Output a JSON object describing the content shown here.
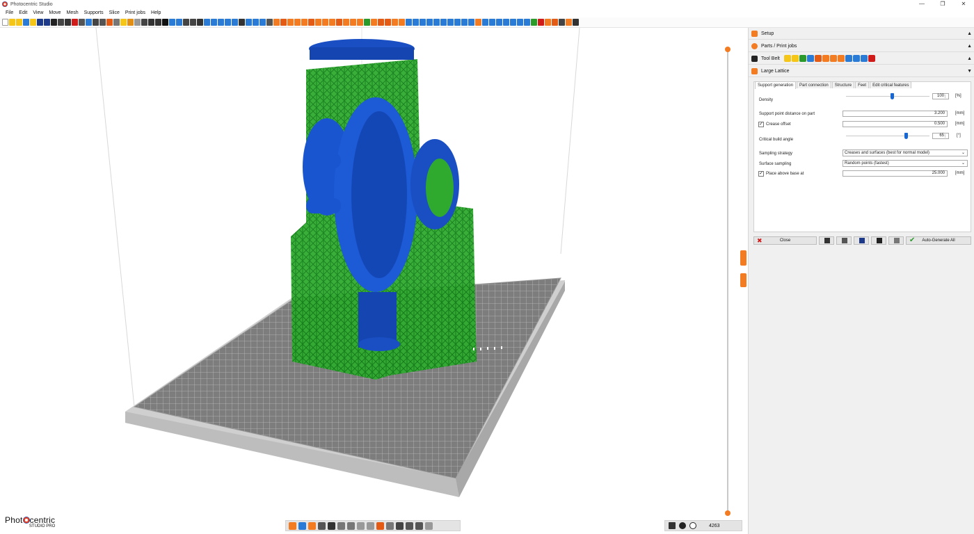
{
  "window": {
    "title": "Photocentric Studio",
    "controls": [
      "—",
      "❐",
      "✕"
    ]
  },
  "menu": [
    "File",
    "Edit",
    "View",
    "Move",
    "Mesh",
    "Supports",
    "Slice",
    "Print jobs",
    "Help"
  ],
  "toolbar_colors": [
    "#ffffff",
    "#f5c518",
    "#f5c518",
    "#2a7bd5",
    "#f5c518",
    "#1d3a8a",
    "#1d3a8a",
    "#222",
    "#444",
    "#333",
    "#d01b1b",
    "#555",
    "#2a7bd5",
    "#444",
    "#555",
    "#e35b14",
    "#777",
    "#f5c518",
    "#e38e14",
    "#999",
    "#444",
    "#333",
    "#333",
    "#111",
    "#2a7bd5",
    "#2a7bd5",
    "#444",
    "#444",
    "#333",
    "#2a7bd5",
    "#2a7bd5",
    "#2a7bd5",
    "#2a7bd5",
    "#2a7bd5",
    "#333",
    "#2a7bd5",
    "#2a7bd5",
    "#2a7bd5",
    "#555",
    "#f37b21",
    "#e35b14",
    "#f37b21",
    "#f37b21",
    "#f37b21",
    "#e35b14",
    "#f37b21",
    "#f37b21",
    "#f37b21",
    "#e35b14",
    "#f37b21",
    "#f37b21",
    "#f37b21",
    "#2a9a2a",
    "#f37b21",
    "#e35b14",
    "#e35b14",
    "#f37b21",
    "#f37b21",
    "#2a7bd5",
    "#2a7bd5",
    "#2a7bd5",
    "#2a7bd5",
    "#2a7bd5",
    "#2a7bd5",
    "#2a7bd5",
    "#2a7bd5",
    "#2a7bd5",
    "#2a7bd5",
    "#f37b21",
    "#2a7bd5",
    "#2a7bd5",
    "#2a7bd5",
    "#2a7bd5",
    "#2a7bd5",
    "#2a7bd5",
    "#2a7bd5",
    "#2a9a2a",
    "#d01b1b",
    "#f37b21",
    "#e35b14",
    "#444",
    "#f37b21",
    "#333"
  ],
  "panel": {
    "sections": [
      {
        "label": "Setup",
        "icon_color": "#f37b21",
        "arrow": "▲"
      },
      {
        "label": "Parts / Print jobs",
        "icon_color": "#f37b21",
        "arrow": "▲"
      },
      {
        "label": "Tool Belt",
        "icon_color": "#222",
        "arrow": "▲"
      },
      {
        "label": "Large Lattice",
        "icon_color": "#f37b21",
        "arrow": "▼"
      }
    ],
    "toolbelt_colors": [
      "#f5c518",
      "#f5c518",
      "#2a9a2a",
      "#2a7bd5",
      "#e35b14",
      "#f37b21",
      "#f37b21",
      "#f37b21",
      "#2a7bd5",
      "#2a7bd5",
      "#2a7bd5",
      "#d01b1b"
    ],
    "tabs": [
      "Support generation",
      "Part connection",
      "Structure",
      "Feet",
      "Edit critical features"
    ],
    "rows": {
      "density": {
        "label": "Density",
        "value": "100",
        "unit": "[%]",
        "level": 0.55
      },
      "spacing": {
        "label": "Support point distance on part",
        "value": "3.200",
        "unit": "[mm]"
      },
      "crease": {
        "label": "Crease offset",
        "value": "0.500",
        "unit": "[mm]",
        "check": "✓"
      },
      "angle": {
        "label": "Critical build angle",
        "value": "65",
        "unit": "[°]",
        "level": 0.72
      },
      "sampling_strategy": {
        "label": "Sampling strategy",
        "value": "Creases and surfaces (best for normal model)"
      },
      "surface_sampling": {
        "label": "Surface sampling",
        "value": "Random points (fastest)"
      },
      "place_above": {
        "label": "Place above base at",
        "value": "25.000",
        "unit": "[mm]",
        "check": "✓"
      }
    },
    "actions": {
      "close": "Close",
      "auto": "Auto-Generate All"
    }
  },
  "bottom_colors": [
    "#f37b21",
    "#2a7bd5",
    "#f37b21",
    "#555",
    "#333",
    "#777",
    "#777",
    "#999",
    "#999",
    "#e35b14",
    "#777",
    "#444",
    "#555",
    "#555",
    "#999"
  ],
  "status": {
    "count": "4263"
  },
  "logo": {
    "brand_left": "Phot",
    "brand_right": "centric",
    "sub": "STUDIO PRO"
  }
}
